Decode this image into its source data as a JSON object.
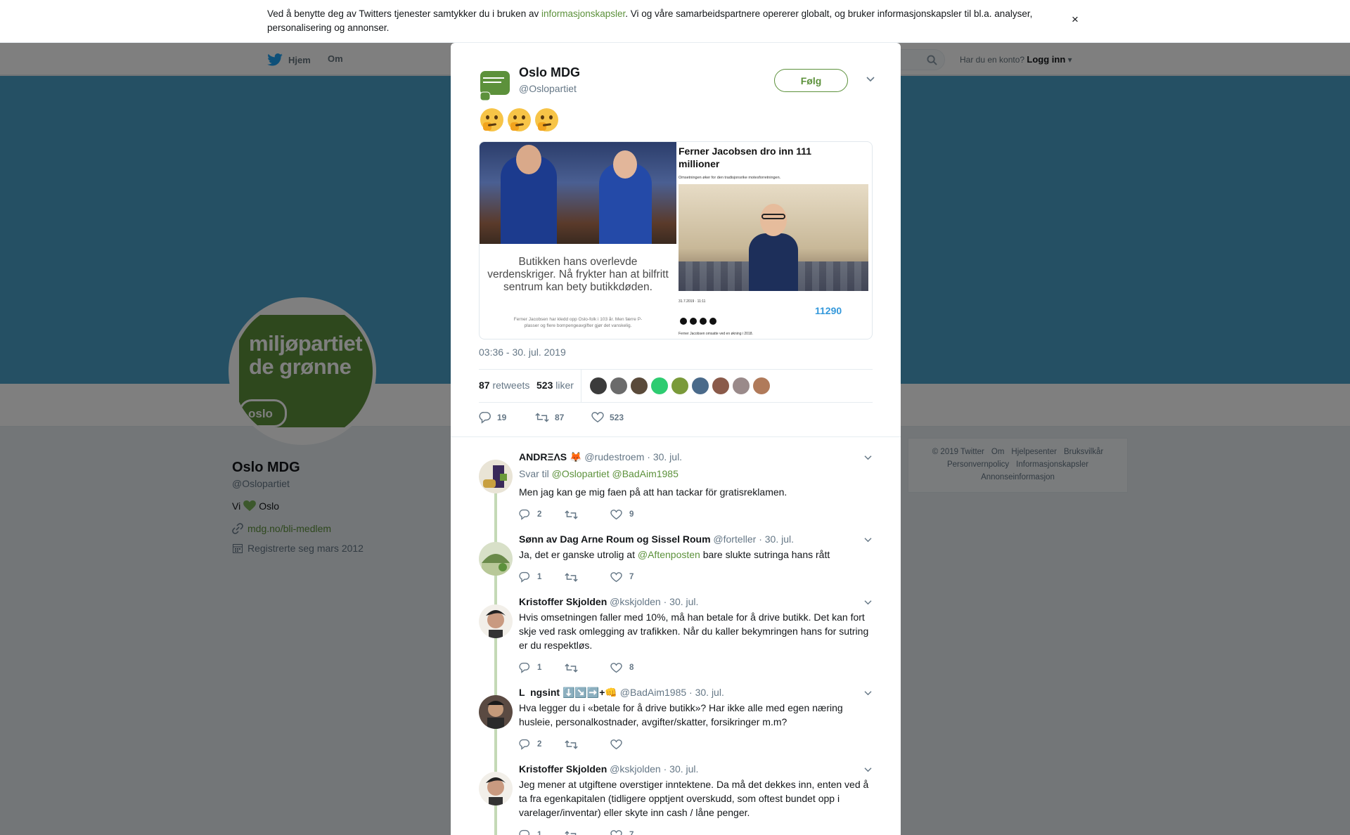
{
  "cookie": {
    "text_before": "Ved å benytte deg av Twitters tjenester samtykker du i bruken av ",
    "link": "informasjonskapsler",
    "text_after": ". Vi og våre samarbeidspartnere opererer globalt, og bruker informasjonskapsler til bl.a. analyser, personalisering og annonser.",
    "close": "×"
  },
  "nav": {
    "home": "Hjem",
    "about": "Om",
    "account_prompt": "Har du en konto?",
    "login": "Logg inn"
  },
  "profile": {
    "avatar_line1": "miljøpartiet",
    "avatar_line2": "de grønne",
    "avatar_badge": "oslo",
    "name": "Oslo MDG",
    "handle": "@Oslopartiet",
    "bio_before": "Vi",
    "bio_after": "Oslo",
    "url": "mdg.no/bli-medlem",
    "joined": "Registrerte seg mars 2012"
  },
  "footer": {
    "links_row1": [
      "© 2019 Twitter",
      "Om",
      "Hjelpesenter",
      "Bruksvilkår"
    ],
    "links_row2": [
      "Personvernpolicy",
      "Informasjonskapsler"
    ],
    "links_row3": [
      "Annonseinformasjon"
    ]
  },
  "overlay_close": "×",
  "tweet": {
    "name": "Oslo MDG",
    "handle": "@Oslopartiet",
    "follow": "Følg",
    "media": {
      "left_caption": "Butikken hans overlevde verdenskriger. Nå frykter han at bilfritt sentrum kan bety butikkdøden.",
      "left_small": "Ferner Jacobsen har kledd opp Oslo-folk i 103 år. Men færre P-plasser og flere bompengeavgifter gjør det vanskelig.",
      "right_title": "Ferner Jacobsen dro inn 111 millioner",
      "right_sub": "Omsetningen øker for den tradisjonsrike motesforretningen.",
      "right_meta": "31.7.2019 · 11:11",
      "right_count": "11290",
      "right_foot": "Ferner Jacobsen omsatte ved en økning i 2018."
    },
    "timestamp": "03:36 - 30. jul. 2019",
    "retweets": "87",
    "retweets_label": "retweets",
    "likes": "523",
    "likes_label": "liker",
    "liker_colors": [
      "#3b3b3b",
      "#6b6b6b",
      "#5a4a3a",
      "#2ecc71",
      "#7a9a3a",
      "#4a6a8a",
      "#8a5a4a",
      "#9a8a8a",
      "#b07a5a"
    ],
    "actions": {
      "replies": "19",
      "retweets": "87",
      "likes": "523"
    }
  },
  "replies": [
    {
      "name": "ANDRΞΛS 🦊",
      "handle": "@rudestroem",
      "date": "· 30. jul.",
      "reply_to_label": "Svar til",
      "reply_to": [
        "@Oslopartiet",
        "@BadAim1985"
      ],
      "text": "Men jag kan ge mig faen på att han tackar för gratisreklamen.",
      "replies": "2",
      "retweets": "",
      "likes": "9"
    },
    {
      "name": "Sønn av Dag Arne Roum og Sissel Roum",
      "handle": "@forteller",
      "date": "· 30. jul.",
      "text_before": "Ja, det er ganske utrolig at ",
      "mention": "@Aftenposten",
      "text_after": " bare slukte sutringa hans rått",
      "replies": "1",
      "retweets": "",
      "likes": "7"
    },
    {
      "name": "Kristoffer Skjolden",
      "handle": "@kskjolden",
      "date": "· 30. jul.",
      "text": "Hvis omsetningen faller med 10%, må han betale for å drive butikk. Det kan fort skje ved rask omlegging av trafikken. Når du kaller bekymringen hans for sutring er du respektløs.",
      "replies": "1",
      "retweets": "",
      "likes": "8"
    },
    {
      "name": "L⁠ ⁠ ngsint ⬇️↘️➡️+👊",
      "handle": "@BadAim1985",
      "date": "· 30. jul.",
      "text": "Hva legger du i «betale for å drive butikk»? Har ikke alle med egen næring husleie, personalkostnader, avgifter/skatter, forsikringer m.m?",
      "replies": "2",
      "retweets": "",
      "likes": ""
    },
    {
      "name": "Kristoffer Skjolden",
      "handle": "@kskjolden",
      "date": "· 30. jul.",
      "text": "Jeg mener at utgiftene overstiger inntektene. Da må det dekkes inn, enten ved å ta fra egenkapitalen (tidligere opptjent overskudd, som oftest bundet opp i varelager/inventar) eller skyte inn cash / låne penger.",
      "replies": "1",
      "retweets": "",
      "likes": "7"
    }
  ],
  "colors": {
    "accent": "#5c913b",
    "banner": "#4aa1c8",
    "thread_line": "#c4d9b6"
  }
}
